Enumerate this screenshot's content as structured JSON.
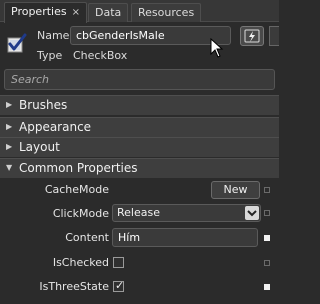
{
  "tabs": [
    {
      "label": "Properties",
      "close": "×",
      "active": true
    },
    {
      "label": "Data",
      "active": false
    },
    {
      "label": "Resources",
      "active": false
    }
  ],
  "header": {
    "icon": "checkbox-icon",
    "name_label": "Name",
    "name_value": "cbGenderIsMale",
    "type_label": "Type",
    "type_value": "CheckBox",
    "events_icon": "lightning-icon"
  },
  "search": {
    "placeholder": "Search"
  },
  "categories": [
    {
      "label": "Brushes",
      "expanded": false
    },
    {
      "label": "Appearance",
      "expanded": false
    },
    {
      "label": "Layout",
      "expanded": false
    },
    {
      "label": "Common Properties",
      "expanded": true
    }
  ],
  "properties": {
    "cachemode": {
      "label": "CacheMode",
      "button": "New"
    },
    "clickmode": {
      "label": "ClickMode",
      "value": "Release"
    },
    "content": {
      "label": "Content",
      "value": "Hím"
    },
    "ischecked": {
      "label": "IsChecked",
      "checked": false
    },
    "isthreestate": {
      "label": "IsThreeState",
      "checked": true,
      "check_glyph": "✓"
    }
  },
  "colors": {
    "background": "#2b2b2b",
    "category": "#3e3e3e",
    "text": "#e6e6e6"
  }
}
